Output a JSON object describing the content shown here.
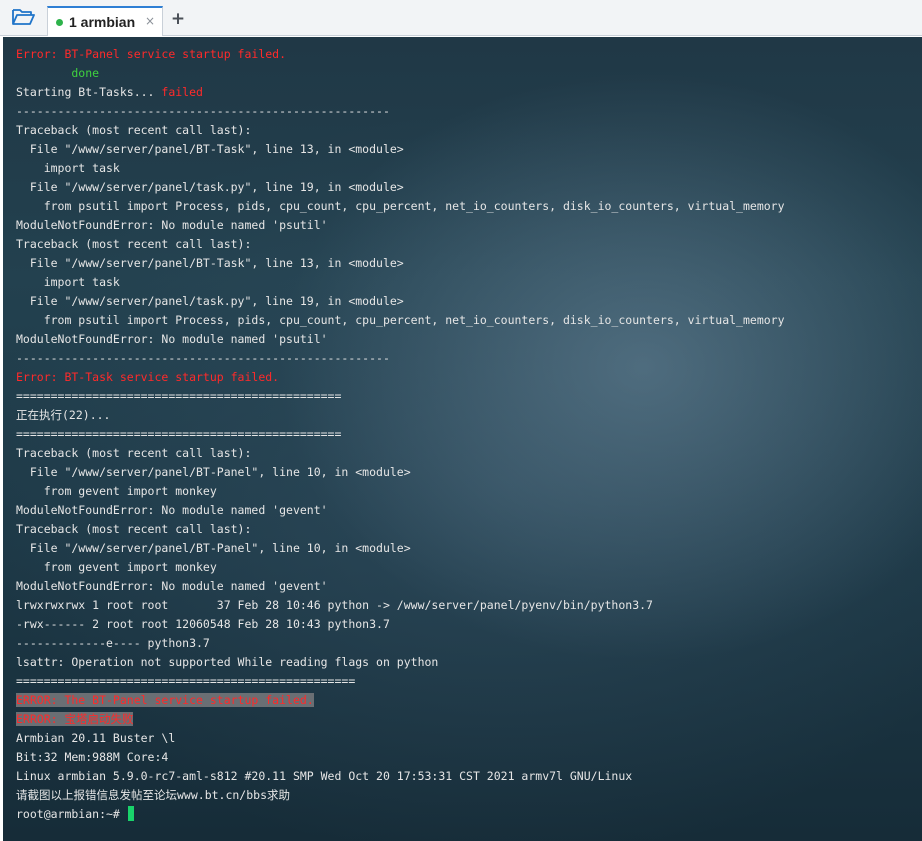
{
  "tabs": {
    "items": [
      {
        "label": "1 armbian",
        "close": "×"
      }
    ],
    "add_label": "+"
  },
  "terminal": {
    "lines": [
      {
        "segments": [
          {
            "text": "Error: BT-Panel service startup failed.",
            "color": "red"
          }
        ]
      },
      {
        "segments": [
          {
            "text": "        done",
            "color": "green"
          }
        ]
      },
      {
        "segments": [
          {
            "text": "Starting Bt-Tasks... ",
            "color": "default"
          },
          {
            "text": "failed",
            "color": "red"
          }
        ]
      },
      {
        "segments": [
          {
            "text": "------------------------------------------------------",
            "color": "default"
          }
        ]
      },
      {
        "segments": [
          {
            "text": "Traceback (most recent call last):",
            "color": "default"
          }
        ]
      },
      {
        "segments": [
          {
            "text": "  File \"/www/server/panel/BT-Task\", line 13, in <module>",
            "color": "default"
          }
        ]
      },
      {
        "segments": [
          {
            "text": "    import task",
            "color": "default"
          }
        ]
      },
      {
        "segments": [
          {
            "text": "  File \"/www/server/panel/task.py\", line 19, in <module>",
            "color": "default"
          }
        ]
      },
      {
        "segments": [
          {
            "text": "    from psutil import Process, pids, cpu_count, cpu_percent, net_io_counters, disk_io_counters, virtual_memory",
            "color": "default"
          }
        ]
      },
      {
        "segments": [
          {
            "text": "ModuleNotFoundError: No module named 'psutil'",
            "color": "default"
          }
        ]
      },
      {
        "segments": [
          {
            "text": "Traceback (most recent call last):",
            "color": "default"
          }
        ]
      },
      {
        "segments": [
          {
            "text": "  File \"/www/server/panel/BT-Task\", line 13, in <module>",
            "color": "default"
          }
        ]
      },
      {
        "segments": [
          {
            "text": "    import task",
            "color": "default"
          }
        ]
      },
      {
        "segments": [
          {
            "text": "  File \"/www/server/panel/task.py\", line 19, in <module>",
            "color": "default"
          }
        ]
      },
      {
        "segments": [
          {
            "text": "    from psutil import Process, pids, cpu_count, cpu_percent, net_io_counters, disk_io_counters, virtual_memory",
            "color": "default"
          }
        ]
      },
      {
        "segments": [
          {
            "text": "ModuleNotFoundError: No module named 'psutil'",
            "color": "default"
          }
        ]
      },
      {
        "segments": [
          {
            "text": "------------------------------------------------------",
            "color": "default"
          }
        ]
      },
      {
        "segments": [
          {
            "text": "Error: BT-Task service startup failed.",
            "color": "red"
          }
        ]
      },
      {
        "segments": [
          {
            "text": "===============================================",
            "color": "default"
          }
        ]
      },
      {
        "segments": [
          {
            "text": "正在执行(22)...",
            "color": "default"
          }
        ]
      },
      {
        "segments": [
          {
            "text": "===============================================",
            "color": "default"
          }
        ]
      },
      {
        "segments": [
          {
            "text": "Traceback (most recent call last):",
            "color": "default"
          }
        ]
      },
      {
        "segments": [
          {
            "text": "  File \"/www/server/panel/BT-Panel\", line 10, in <module>",
            "color": "default"
          }
        ]
      },
      {
        "segments": [
          {
            "text": "    from gevent import monkey",
            "color": "default"
          }
        ]
      },
      {
        "segments": [
          {
            "text": "ModuleNotFoundError: No module named 'gevent'",
            "color": "default"
          }
        ]
      },
      {
        "segments": [
          {
            "text": "Traceback (most recent call last):",
            "color": "default"
          }
        ]
      },
      {
        "segments": [
          {
            "text": "  File \"/www/server/panel/BT-Panel\", line 10, in <module>",
            "color": "default"
          }
        ]
      },
      {
        "segments": [
          {
            "text": "    from gevent import monkey",
            "color": "default"
          }
        ]
      },
      {
        "segments": [
          {
            "text": "ModuleNotFoundError: No module named 'gevent'",
            "color": "default"
          }
        ]
      },
      {
        "segments": [
          {
            "text": "lrwxrwxrwx 1 root root       37 Feb 28 10:46 python -> /www/server/panel/pyenv/bin/python3.7",
            "color": "default"
          }
        ]
      },
      {
        "segments": [
          {
            "text": "-rwx------ 2 root root 12060548 Feb 28 10:43 python3.7",
            "color": "default"
          }
        ]
      },
      {
        "segments": [
          {
            "text": "-------------e---- python3.7",
            "color": "default"
          }
        ]
      },
      {
        "segments": [
          {
            "text": "lsattr: Operation not supported While reading flags on python",
            "color": "default"
          }
        ]
      },
      {
        "segments": [
          {
            "text": "=================================================",
            "color": "default"
          }
        ]
      },
      {
        "segments": [
          {
            "text": "ERROR: The BT-Panel service startup failed.",
            "color": "highlight"
          }
        ]
      },
      {
        "segments": [
          {
            "text": "ERROR: 宝塔启动失败",
            "color": "highlight"
          }
        ]
      },
      {
        "segments": [
          {
            "text": "Armbian 20.11 Buster \\l",
            "color": "default"
          }
        ]
      },
      {
        "segments": [
          {
            "text": "Bit:32 Mem:988M Core:4",
            "color": "default"
          }
        ]
      },
      {
        "segments": [
          {
            "text": "Linux armbian 5.9.0-rc7-aml-s812 #20.11 SMP Wed Oct 20 17:53:31 CST 2021 armv7l GNU/Linux",
            "color": "default"
          }
        ]
      },
      {
        "segments": [
          {
            "text": "请截图以上报错信息发帖至论坛www.bt.cn/bbs求助",
            "color": "default"
          }
        ]
      }
    ],
    "prompt": "root@armbian:~#"
  },
  "colors": {
    "default_text": "#e6e6e6",
    "error_red": "#ff2a2a",
    "done_green": "#3fd13f",
    "cursor_green": "#19d36b",
    "tab_dot": "#2db24a",
    "tab_accent": "#2f7fd4"
  },
  "icons": {
    "folder": "open-folder-icon",
    "tab_status": "green-dot-icon",
    "close": "close-icon",
    "add": "plus-icon"
  }
}
